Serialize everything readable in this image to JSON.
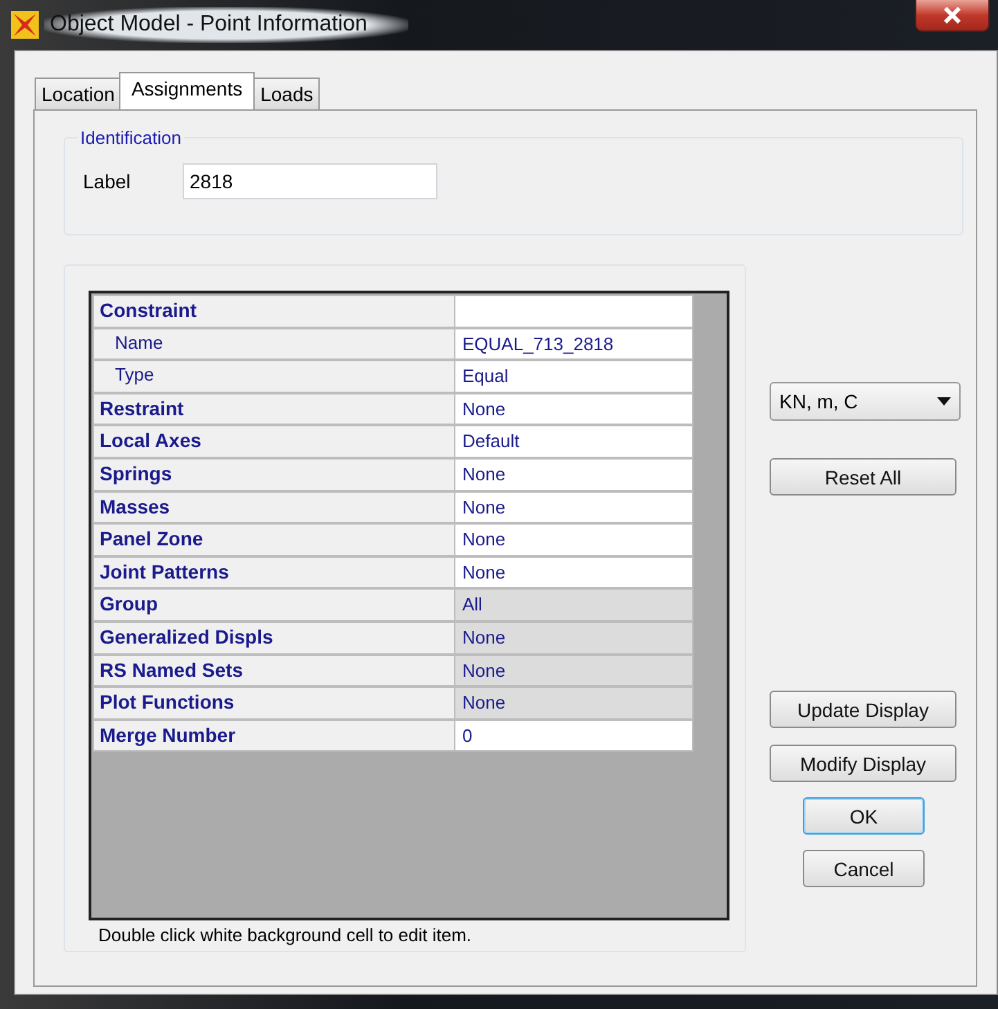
{
  "window": {
    "title": "Object Model - Point Information"
  },
  "tabs": [
    {
      "label": "Location",
      "selected": false
    },
    {
      "label": "Assignments",
      "selected": true
    },
    {
      "label": "Loads",
      "selected": false
    }
  ],
  "identification": {
    "title": "Identification",
    "label": "Label",
    "value": "2818"
  },
  "table": {
    "rows": [
      {
        "label": "Constraint",
        "kind": "group",
        "editable": true
      },
      {
        "label": "Name",
        "kind": "sub",
        "value": "EQUAL_713_2818",
        "editable": true
      },
      {
        "label": "Type",
        "kind": "sub",
        "value": "Equal",
        "editable": true
      },
      {
        "label": "Restraint",
        "kind": "group",
        "value": "None",
        "editable": true
      },
      {
        "label": "Local Axes",
        "kind": "group",
        "value": "Default",
        "editable": true
      },
      {
        "label": "Springs",
        "kind": "group",
        "value": "None",
        "editable": true
      },
      {
        "label": "Masses",
        "kind": "group",
        "value": "None",
        "editable": true
      },
      {
        "label": "Panel Zone",
        "kind": "group",
        "value": "None",
        "editable": true
      },
      {
        "label": "Joint Patterns",
        "kind": "group",
        "value": "None",
        "editable": true
      },
      {
        "label": "Group",
        "kind": "group",
        "value": "All",
        "editable": false
      },
      {
        "label": "Generalized Displs",
        "kind": "group",
        "value": "None",
        "editable": false
      },
      {
        "label": "RS Named Sets",
        "kind": "group",
        "value": "None",
        "editable": false
      },
      {
        "label": "Plot Functions",
        "kind": "group",
        "value": "None",
        "editable": false
      },
      {
        "label": "Merge Number",
        "kind": "group",
        "value": "0",
        "editable": true
      }
    ],
    "hint": "Double click white background cell to edit item."
  },
  "units": {
    "value": "KN, m, C"
  },
  "buttons": [
    {
      "label": "Reset All",
      "kind": "wide"
    },
    {
      "label": "Update Display",
      "kind": "wide"
    },
    {
      "label": "Modify Display",
      "kind": "wide"
    },
    {
      "label": "OK",
      "kind": "default"
    },
    {
      "label": "Cancel",
      "kind": "narrow"
    }
  ]
}
